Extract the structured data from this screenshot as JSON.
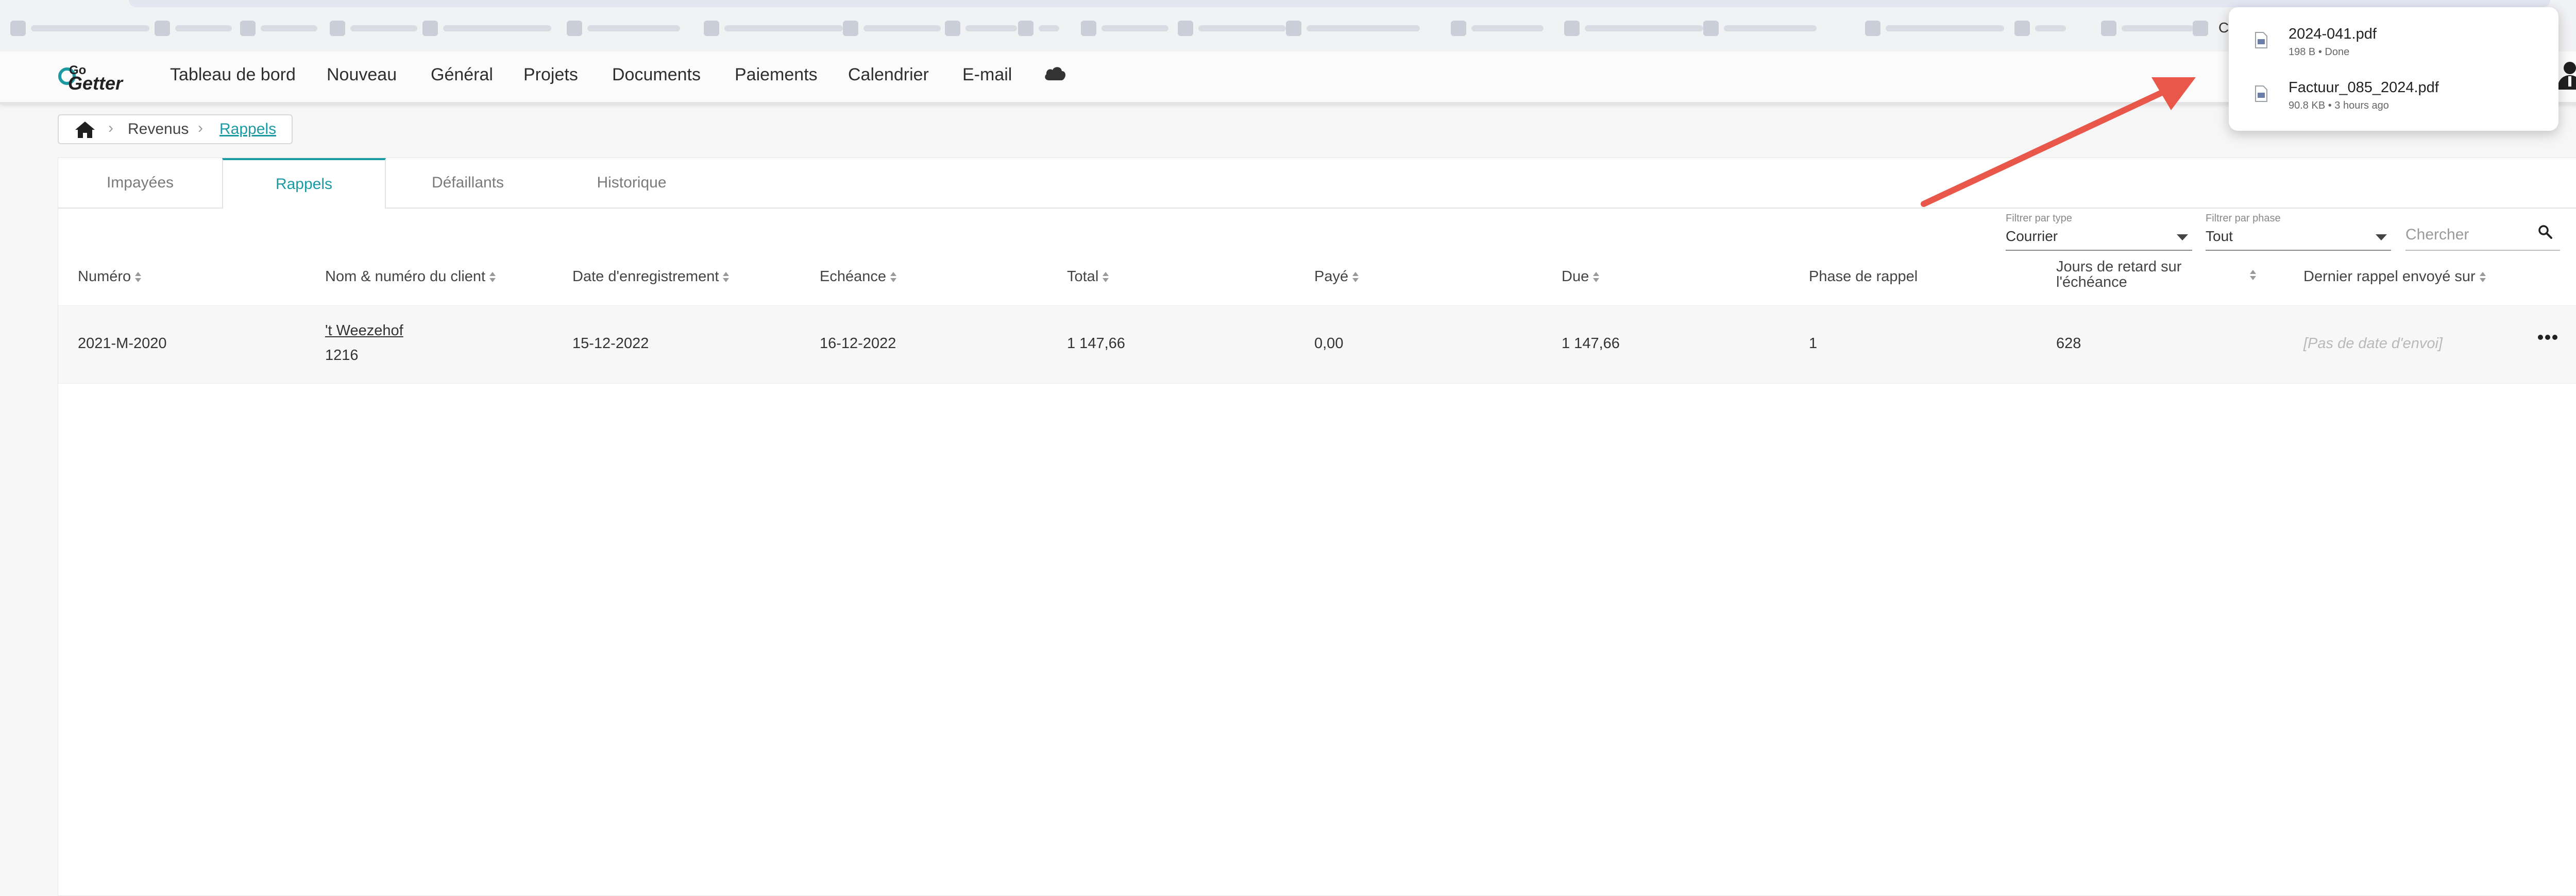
{
  "browser": {
    "bookmarks_more_label": "»",
    "edge_glyph": "C"
  },
  "nav": {
    "logo_top": "Go",
    "logo_bottom": "Getter",
    "items": [
      "Tableau de bord",
      "Nouveau",
      "Général",
      "Projets",
      "Documents",
      "Paiements",
      "Calendrier",
      "E-mail"
    ],
    "cloud_icon": "cloud-icon",
    "user_icon": "user-icon"
  },
  "breadcrumb": {
    "home_icon": "home-icon",
    "items": [
      "Revenus",
      "Rappels"
    ]
  },
  "tabs": [
    {
      "label": "Impayées",
      "active": false
    },
    {
      "label": "Rappels",
      "active": true
    },
    {
      "label": "Défaillants",
      "active": false
    },
    {
      "label": "Historique",
      "active": false
    }
  ],
  "filters": {
    "type": {
      "label": "Filtrer par type",
      "value": "Courrier"
    },
    "phase": {
      "label": "Filtrer par phase",
      "value": "Tout"
    },
    "search": {
      "placeholder": "Chercher"
    }
  },
  "table": {
    "headers": [
      "Numéro",
      "Nom & numéro du client",
      "Date d'enregistrement",
      "Echéance",
      "Total",
      "Payé",
      "Due",
      "Phase de rappel",
      "Jours de retard sur l'échéance",
      "Dernier rappel envoyé sur"
    ],
    "header_jours_line1": "Jours de retard sur",
    "header_jours_line2": "l'échéance",
    "rows": [
      {
        "numero": "2021-M-2020",
        "client_name": "'t Weezehof",
        "client_number": "1216",
        "date_enregistrement": "15-12-2022",
        "echeance": "16-12-2022",
        "total": "1 147,66",
        "paye": "0,00",
        "due": "1 147,66",
        "phase": "1",
        "jours_retard": "628",
        "dernier_rappel": "[Pas de date d'envoi]"
      }
    ]
  },
  "downloads": [
    {
      "name": "2024-041.pdf",
      "meta": "198 B • Done"
    },
    {
      "name": "Factuur_085_2024.pdf",
      "meta": "90.8 KB • 3 hours ago"
    }
  ],
  "colors": {
    "accent": "#1a9aa3",
    "arrow": "#e8574a"
  }
}
